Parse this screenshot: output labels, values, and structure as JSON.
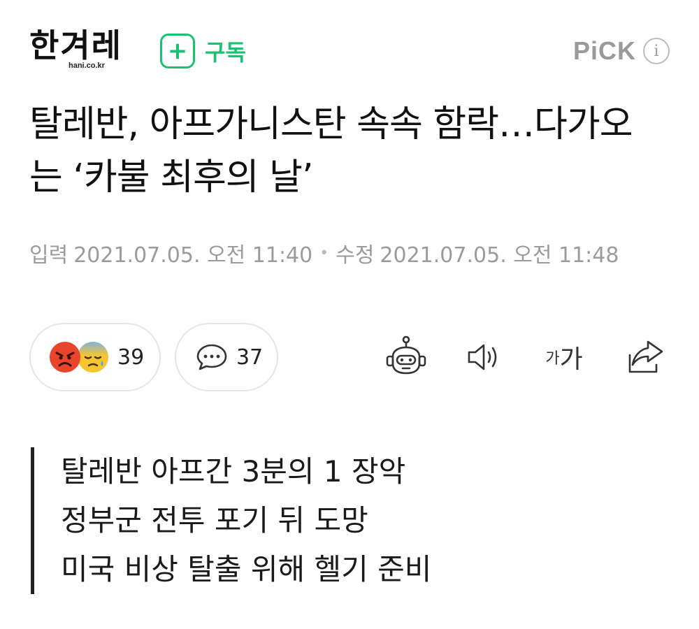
{
  "header": {
    "logo_text": "한겨레",
    "logo_sub": "hani.co.kr",
    "subscribe_label": "구독",
    "pick_label": "PiCK",
    "info_symbol": "i"
  },
  "article": {
    "title": "탈레반, 아프가니스탄 속속 함락…다가오는 ‘카불 최후의 날’",
    "input_label": "입력",
    "input_date": "2021.07.05. 오전 11:40",
    "modified_label": "수정",
    "modified_date": "2021.07.05. 오전 11:48"
  },
  "actions": {
    "reaction_count": "39",
    "comment_count": "37",
    "font_small": "가",
    "font_big": "가"
  },
  "summary": [
    "탈레반 아프간 3분의 1 장악",
    "정부군 전투 포기 뒤 도망",
    "미국 비상 탈출 위해 헬기 준비"
  ],
  "icons": {
    "subscribe": "plus-icon",
    "reaction_1": "angry-face-icon",
    "reaction_2": "sad-sweat-face-icon",
    "comment": "speech-bubble-icon",
    "summary_bot": "robot-icon",
    "audio": "speaker-icon",
    "font_size": "font-size-icon",
    "share": "share-icon"
  },
  "colors": {
    "accent_green": "#19c273",
    "meta_gray": "#9b9b9b",
    "angry_red": "#e8452c",
    "sad_yellow": "#f6c52f"
  }
}
